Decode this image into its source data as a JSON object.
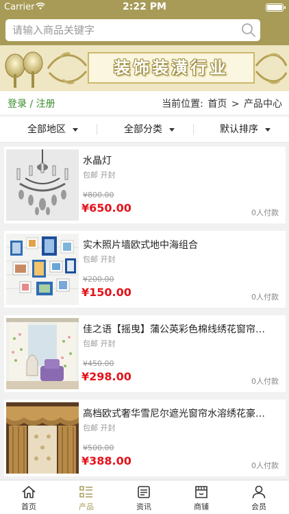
{
  "status_bar": {
    "carrier": "Carrier",
    "time": "2:22 PM"
  },
  "search": {
    "placeholder": "请输入商品关键字"
  },
  "banner": {
    "title": "装饰装潢行业"
  },
  "location_bar": {
    "login": "登录 / 注册",
    "prefix": "当前位置:",
    "path": [
      "首页",
      ">",
      "产品中心"
    ]
  },
  "filters": [
    {
      "label": "全部地区"
    },
    {
      "label": "全部分类"
    },
    {
      "label": "默认排序"
    }
  ],
  "products": [
    {
      "name": "水晶灯",
      "tags": "包邮  开封",
      "old_price": "¥800.00",
      "price": "¥650.00",
      "paid": "0人付款",
      "image": "chandelier"
    },
    {
      "name": "实木照片墙欧式地中海组合",
      "tags": "包邮  开封",
      "old_price": "¥200.00",
      "price": "¥150.00",
      "paid": "0人付款",
      "image": "photo-wall"
    },
    {
      "name": "佳之语【摇曳】蒲公英彩色棉线绣花窗帘…",
      "tags": "包邮  开封",
      "old_price": "¥450.00",
      "price": "¥298.00",
      "paid": "0人付款",
      "image": "curtain-room"
    },
    {
      "name": "高档欧式奢华雪尼尔遮光窗帘水溶绣花豪…",
      "tags": "包邮  开封",
      "old_price": "¥500.00",
      "price": "¥388.00",
      "paid": "0人付款",
      "image": "luxury-curtain"
    }
  ],
  "tabbar": [
    {
      "label": "首页",
      "icon": "home-icon"
    },
    {
      "label": "产品",
      "icon": "list-icon",
      "active": true
    },
    {
      "label": "资讯",
      "icon": "news-icon"
    },
    {
      "label": "商铺",
      "icon": "shop-icon"
    },
    {
      "label": "会员",
      "icon": "user-icon"
    }
  ],
  "colors": {
    "theme": "#a79b57",
    "price": "#e4131b",
    "login": "#3a8b2b"
  }
}
